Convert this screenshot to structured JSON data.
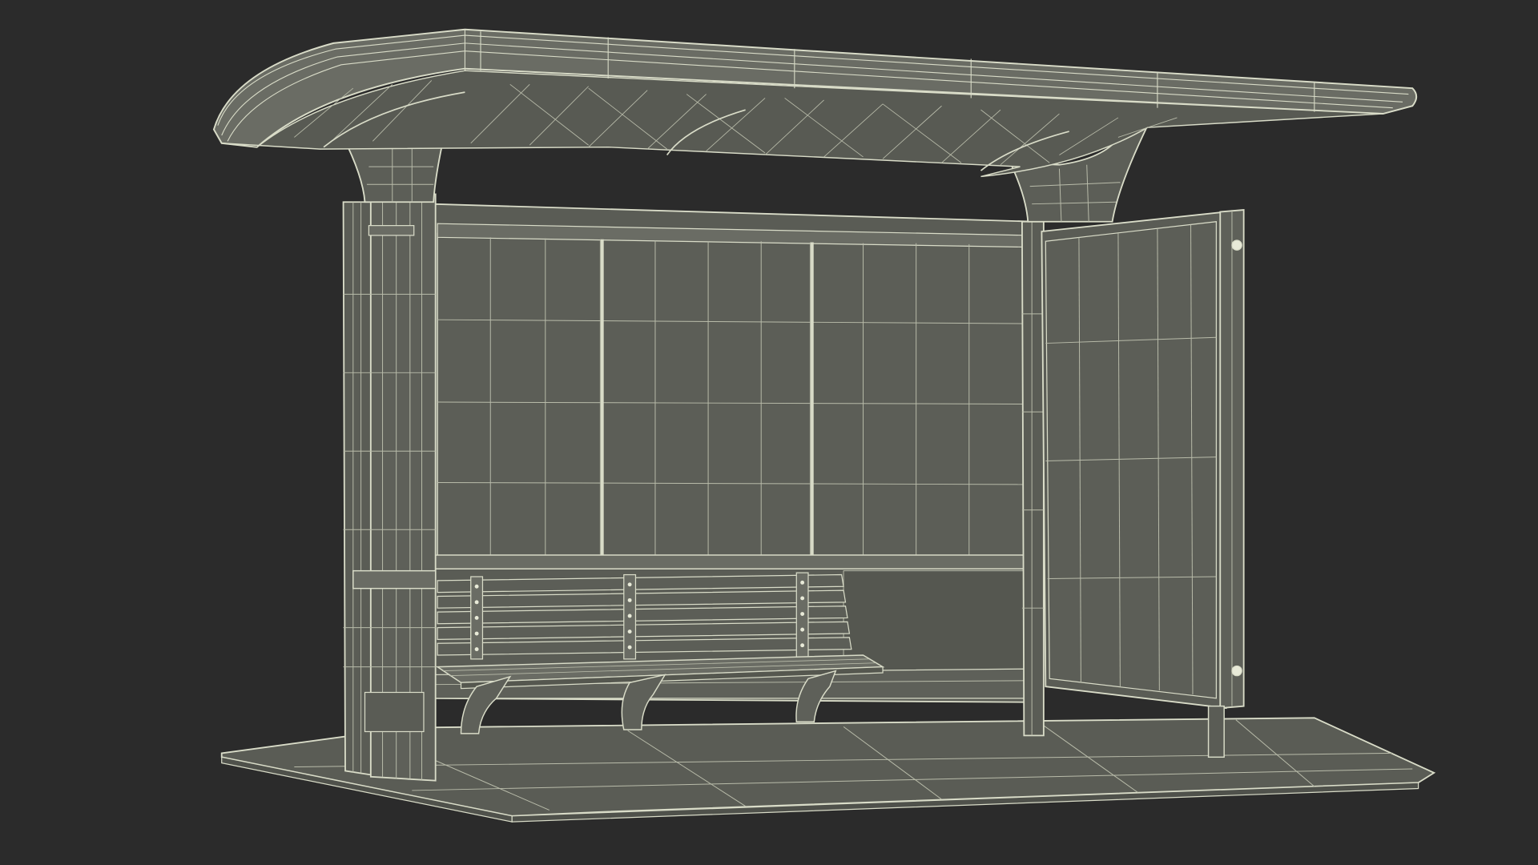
{
  "scene": {
    "subject": "bus-shelter-wireframe",
    "colors": {
      "background": "#2b2b2b",
      "surface": "#5a5c55",
      "surface_dark": "#4f514b",
      "surface_light": "#6a6c64",
      "wire": "#d9dcc8",
      "wire_faint": "#b9bcaa"
    }
  }
}
